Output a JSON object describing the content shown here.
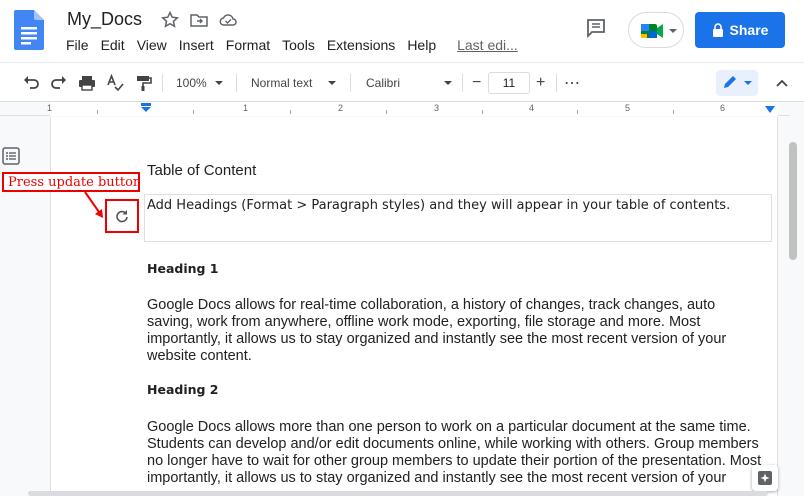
{
  "header": {
    "doc_title": "My_Docs",
    "menu": [
      "File",
      "Edit",
      "View",
      "Insert",
      "Format",
      "Tools",
      "Extensions",
      "Help"
    ],
    "last_edit": "Last edi...",
    "share_label": "Share"
  },
  "toolbar": {
    "zoom": "100%",
    "style": "Normal text",
    "font": "Calibri",
    "font_size": "11",
    "minus": "−",
    "plus": "+",
    "more": "⋯"
  },
  "ruler": {
    "marks": [
      "1",
      "1",
      "2",
      "3",
      "4",
      "5",
      "6"
    ]
  },
  "document": {
    "toc_title": "Table of Content",
    "toc_hint": "Add Headings (Format > Paragraph styles) and they will appear in your table of contents.",
    "heading1": "Heading 1",
    "para1_lines": [
      "Google Docs allows for real-time collaboration, a history of changes, track changes, auto",
      "saving, work from anywhere, offline work mode, exporting, file storage and more. Most",
      "importantly, it allows us to stay organized and instantly see the most recent version of your",
      "website content."
    ],
    "heading2": "Heading 2",
    "para2_lines": [
      "Google Docs allows more than one person to work on a particular document at the same time.",
      "Students can develop and/or edit documents online, while working with others. Group members",
      "no longer have to wait for other group members to update their portion of the presentation. Most",
      "importantly, it allows us to stay organized and instantly see the most recent version of your"
    ]
  },
  "annotation": {
    "callout": "Press update button",
    "color": "#e00000"
  },
  "colors": {
    "accent": "#1a73e8",
    "docs_blue": "#4285f4"
  }
}
